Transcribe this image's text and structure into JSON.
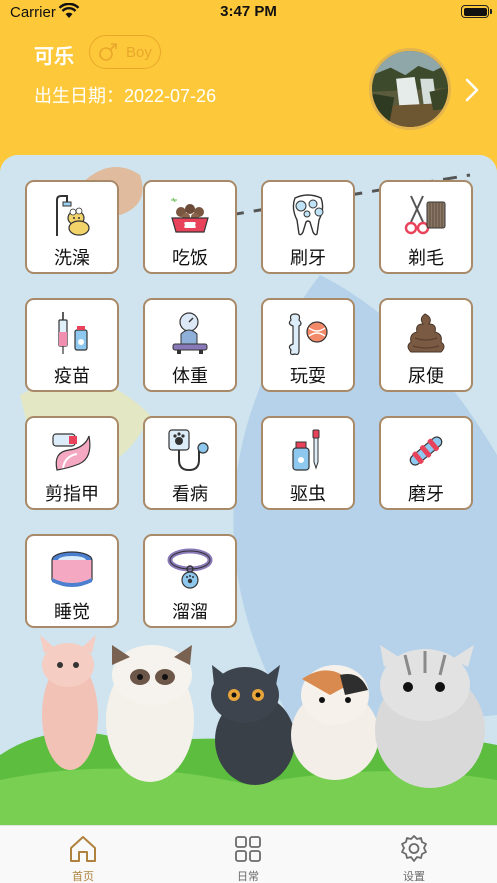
{
  "status_bar": {
    "carrier": "Carrier",
    "time": "3:47 PM"
  },
  "profile": {
    "name": "可乐",
    "gender": "Boy",
    "birthday_label": "出生日期：",
    "birthday": "2022-07-26"
  },
  "tiles": [
    {
      "label": "洗澡",
      "icon": "bath-dog-icon"
    },
    {
      "label": "吃饭",
      "icon": "food-bowl-icon"
    },
    {
      "label": "刷牙",
      "icon": "tooth-brush-icon"
    },
    {
      "label": "剃毛",
      "icon": "scissors-comb-icon"
    },
    {
      "label": "疫苗",
      "icon": "vaccine-icon"
    },
    {
      "label": "体重",
      "icon": "scale-icon"
    },
    {
      "label": "玩耍",
      "icon": "bone-ball-icon"
    },
    {
      "label": "尿便",
      "icon": "poop-icon"
    },
    {
      "label": "剪指甲",
      "icon": "nail-clipper-icon"
    },
    {
      "label": "看病",
      "icon": "stethoscope-icon"
    },
    {
      "label": "驱虫",
      "icon": "dropper-icon"
    },
    {
      "label": "磨牙",
      "icon": "chew-toy-icon"
    },
    {
      "label": "睡觉",
      "icon": "pet-bed-icon"
    },
    {
      "label": "溜溜",
      "icon": "collar-icon"
    }
  ],
  "tabbar": {
    "items": [
      {
        "label": "首页",
        "icon": "home-icon",
        "active": true
      },
      {
        "label": "日常",
        "icon": "grid-icon",
        "active": false
      },
      {
        "label": "设置",
        "icon": "gear-icon",
        "active": false
      }
    ]
  },
  "colors": {
    "header": "#fdc93a",
    "accent": "#e9a72a",
    "tile_border": "#a98a68",
    "tab_active": "#b0823d",
    "tab_inactive": "#6b6b6b"
  }
}
